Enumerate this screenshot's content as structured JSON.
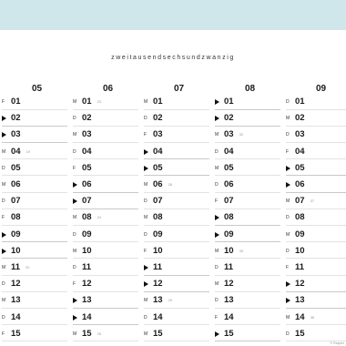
{
  "year_label": "zweitausendsechsundzwanzig",
  "colors": {
    "topband": "#cfe6ea"
  },
  "credit": "© Paapier",
  "columns": [
    {
      "month": "05",
      "days": [
        {
          "n": "01",
          "a": "F"
        },
        {
          "n": "02",
          "a": "▶"
        },
        {
          "n": "03",
          "a": "▶"
        },
        {
          "n": "04",
          "a": "M",
          "kw": "19"
        },
        {
          "n": "05",
          "a": "D"
        },
        {
          "n": "06",
          "a": "M"
        },
        {
          "n": "07",
          "a": "D"
        },
        {
          "n": "08",
          "a": "F"
        },
        {
          "n": "09",
          "a": "▶"
        },
        {
          "n": "10",
          "a": "▶"
        },
        {
          "n": "11",
          "a": "M",
          "kw": "20"
        },
        {
          "n": "12",
          "a": "D"
        },
        {
          "n": "13",
          "a": "M"
        },
        {
          "n": "14",
          "a": "D"
        },
        {
          "n": "15",
          "a": "F"
        }
      ]
    },
    {
      "month": "06",
      "days": [
        {
          "n": "01",
          "a": "M",
          "kw": "23"
        },
        {
          "n": "02",
          "a": "D"
        },
        {
          "n": "03",
          "a": "M"
        },
        {
          "n": "04",
          "a": "D"
        },
        {
          "n": "05",
          "a": "F"
        },
        {
          "n": "06",
          "a": "▶"
        },
        {
          "n": "07",
          "a": "▶"
        },
        {
          "n": "08",
          "a": "M",
          "kw": "24"
        },
        {
          "n": "09",
          "a": "D"
        },
        {
          "n": "10",
          "a": "M"
        },
        {
          "n": "11",
          "a": "D"
        },
        {
          "n": "12",
          "a": "F"
        },
        {
          "n": "13",
          "a": "▶"
        },
        {
          "n": "14",
          "a": "▶"
        },
        {
          "n": "15",
          "a": "M",
          "kw": "25"
        }
      ]
    },
    {
      "month": "07",
      "days": [
        {
          "n": "01",
          "a": "M"
        },
        {
          "n": "02",
          "a": "D"
        },
        {
          "n": "03",
          "a": "F"
        },
        {
          "n": "04",
          "a": "▶"
        },
        {
          "n": "05",
          "a": "▶"
        },
        {
          "n": "06",
          "a": "M",
          "kw": "28"
        },
        {
          "n": "07",
          "a": "D"
        },
        {
          "n": "08",
          "a": "M"
        },
        {
          "n": "09",
          "a": "D"
        },
        {
          "n": "10",
          "a": "F"
        },
        {
          "n": "11",
          "a": "▶"
        },
        {
          "n": "12",
          "a": "▶"
        },
        {
          "n": "13",
          "a": "M",
          "kw": "29"
        },
        {
          "n": "14",
          "a": "D"
        },
        {
          "n": "15",
          "a": "M"
        }
      ]
    },
    {
      "month": "08",
      "days": [
        {
          "n": "01",
          "a": "▶"
        },
        {
          "n": "02",
          "a": "▶"
        },
        {
          "n": "03",
          "a": "M",
          "kw": "32"
        },
        {
          "n": "04",
          "a": "D"
        },
        {
          "n": "05",
          "a": "M"
        },
        {
          "n": "06",
          "a": "D"
        },
        {
          "n": "07",
          "a": "F"
        },
        {
          "n": "08",
          "a": "▶"
        },
        {
          "n": "09",
          "a": "▶"
        },
        {
          "n": "10",
          "a": "M",
          "kw": "33"
        },
        {
          "n": "11",
          "a": "D"
        },
        {
          "n": "12",
          "a": "M"
        },
        {
          "n": "13",
          "a": "D"
        },
        {
          "n": "14",
          "a": "F"
        },
        {
          "n": "15",
          "a": "▶"
        }
      ]
    },
    {
      "month": "09",
      "days": [
        {
          "n": "01",
          "a": "D"
        },
        {
          "n": "02",
          "a": "M"
        },
        {
          "n": "03",
          "a": "D"
        },
        {
          "n": "04",
          "a": "F"
        },
        {
          "n": "05",
          "a": "▶"
        },
        {
          "n": "06",
          "a": "▶"
        },
        {
          "n": "07",
          "a": "M",
          "kw": "37"
        },
        {
          "n": "08",
          "a": "D"
        },
        {
          "n": "09",
          "a": "M"
        },
        {
          "n": "10",
          "a": "D"
        },
        {
          "n": "11",
          "a": "F"
        },
        {
          "n": "12",
          "a": "▶"
        },
        {
          "n": "13",
          "a": "▶"
        },
        {
          "n": "14",
          "a": "M",
          "kw": "38"
        },
        {
          "n": "15",
          "a": "D"
        }
      ]
    }
  ]
}
